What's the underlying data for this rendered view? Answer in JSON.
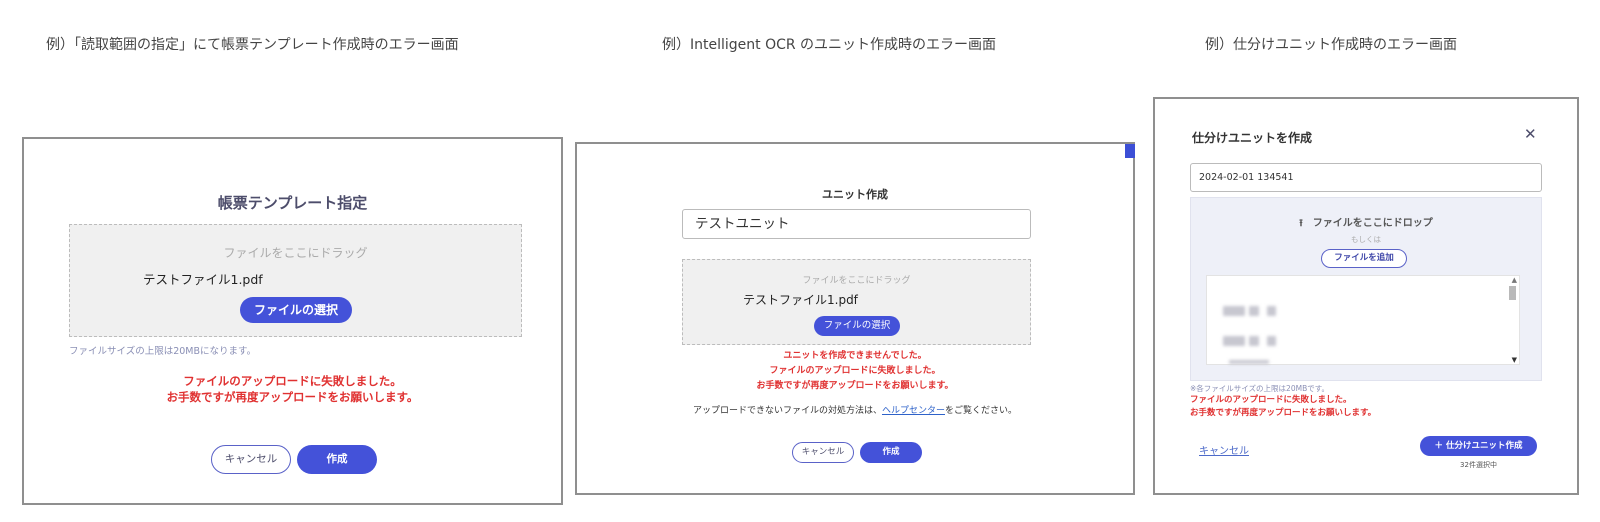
{
  "captions": [
    "例）「読取範囲の指定」にて帳票テンプレート作成時のエラー画面",
    "例）Intelligent OCR のユニット作成時のエラー画面",
    "例）仕分けユニット作成時のエラー画面"
  ],
  "panel1": {
    "title": "帳票テンプレート指定",
    "drop_hint": "ファイルをここにドラッグ",
    "file_name": "テストファイル1.pdf",
    "select_button": "ファイルの選択",
    "size_note": "ファイルサイズの上限は20MBになります。",
    "error_line1": "ファイルのアップロードに失敗しました。",
    "error_line2": "お手数ですが再度アップロードをお願いします。",
    "cancel_button": "キャンセル",
    "create_button": "作成"
  },
  "panel2": {
    "title": "ユニット作成",
    "unit_name_value": "テストユニット",
    "drop_hint": "ファイルをここにドラッグ",
    "file_name": "テストファイル1.pdf",
    "select_button": "ファイルの選択",
    "error_line1": "ユニットを作成できませんでした。",
    "error_line2": "ファイルのアップロードに失敗しました。",
    "error_line3": "お手数ですが再度アップロードをお願いします。",
    "help_prefix": "アップロードできないファイルの対処方法は、",
    "help_link": "ヘルプセンター",
    "help_suffix": "をご覧ください。",
    "cancel_button": "キャンセル",
    "create_button": "作成"
  },
  "panel3": {
    "title": "仕分けユニットを作成",
    "close_symbol": "✕",
    "name_value": "2024-02-01 134541",
    "drop_label": "ファイルをここにドロップ",
    "or_text": "もしくは",
    "add_button": "ファイルを追加",
    "size_note": "※各ファイルサイズの上限は20MBです。",
    "error_line1": "ファイルのアップロードに失敗しました。",
    "error_line2": "お手数ですが再度アップロードをお願いします。",
    "cancel_link": "キャンセル",
    "create_button": "＋ 仕分けユニット作成",
    "selected_count": "32件選択中"
  },
  "icons": {
    "upload": "upload-icon",
    "close": "close-icon",
    "scroll_up": "scroll-up-icon",
    "scroll_down": "scroll-down-icon"
  },
  "colors": {
    "primary": "#4452d9",
    "error": "#e03131",
    "link": "#2e62c9",
    "drop_bg": "#f0f0f0"
  }
}
